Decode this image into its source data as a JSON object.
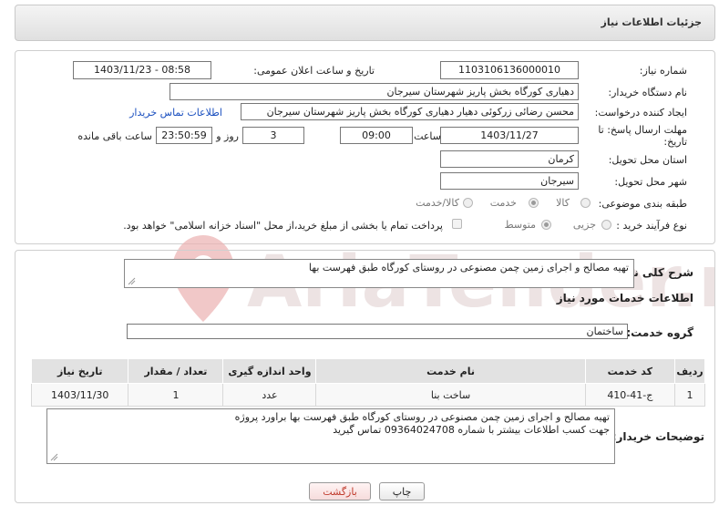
{
  "header": {
    "title": "جزئیات اطلاعات نیاز"
  },
  "form": {
    "need_number_label": "شماره نیاز:",
    "need_number": "1103106136000010",
    "announce_label": "تاریخ و ساعت اعلان عمومی:",
    "announce_value": "1403/11/23 - 08:58",
    "buyer_org_label": "نام دستگاه خریدار:",
    "buyer_org": "دهیاری کورگاه بخش پاریز شهرستان سیرجان",
    "requester_label": "ایجاد کننده درخواست:",
    "requester": "محسن رضائی زرکوئی دهیار دهیاری کورگاه بخش پاریز شهرستان سیرجان",
    "contact_link": "اطلاعات تماس خریدار",
    "deadline_label": "مهلت ارسال پاسخ: تا تاریخ:",
    "deadline_date": "1403/11/27",
    "time_label": "ساعت",
    "deadline_time": "09:00",
    "days_value": "3",
    "days_label": "روز و",
    "remaining_time": "23:50:59",
    "remaining_label": "ساعت باقی مانده",
    "province_label": "استان محل تحویل:",
    "province": "کرمان",
    "city_label": "شهر محل تحویل:",
    "city": "سیرجان",
    "category_label": "طبقه بندی موضوعی:",
    "category_options": [
      "کالا",
      "خدمت",
      "کالا/خدمت"
    ],
    "category_selected": "خدمت",
    "process_label": "نوع فرآیند خرید :",
    "process_options": [
      "جزیی",
      "متوسط"
    ],
    "process_selected": "متوسط",
    "payment_note": "پرداخت تمام یا بخشی از مبلغ خرید،از محل \"اسناد خزانه اسلامی\" خواهد بود."
  },
  "summary": {
    "label": "شرح کلی نیاز:",
    "text": "تهیه مصالح و اجرای زمین  چمن مصنوعی در روستای کورگاه طبق فهرست بها"
  },
  "services": {
    "section_title": "اطلاعات خدمات مورد نیاز",
    "group_label": "گروه خدمت:",
    "group_value": "ساختمان",
    "columns": [
      "ردیف",
      "کد خدمت",
      "نام خدمت",
      "واحد اندازه گیری",
      "تعداد / مقدار",
      "تاریخ نیاز"
    ],
    "rows": [
      {
        "index": "1",
        "code": "ج-41-410",
        "name": "ساخت بنا",
        "unit": "عدد",
        "qty": "1",
        "date": "1403/11/30"
      }
    ]
  },
  "buyer_notes": {
    "label": "توضیحات خریدار:",
    "line1": "تهیه مصالح و اجرای زمین  چمن مصنوعی در روستای کورگاه طبق فهرست بها براورد پروژه",
    "line2": "جهت کسب اطلاعات بیشتر با شماره 09364024708 تماس گیرید"
  },
  "buttons": {
    "print": "چاپ",
    "back": "بازگشت"
  },
  "watermark": {
    "text": "AriaTender.neT"
  },
  "colors": {
    "accent_link": "#1a4fbf",
    "back_button_text": "#c0392b",
    "watermark": "#e9a7a7"
  }
}
